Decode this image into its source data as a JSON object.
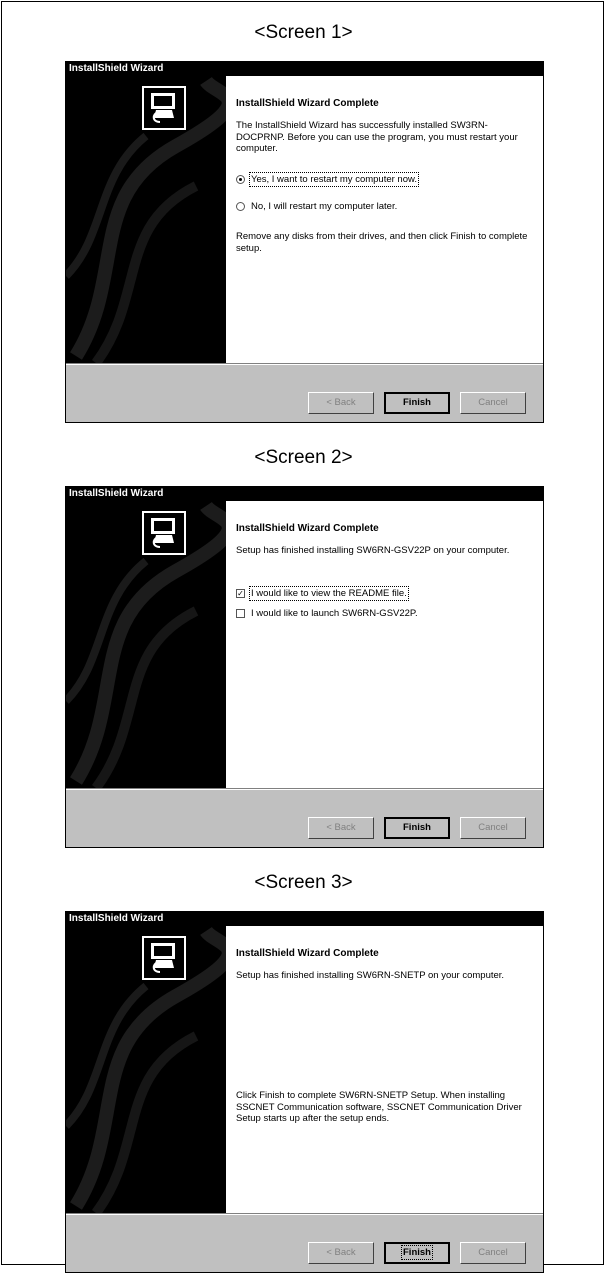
{
  "screens": [
    {
      "caption": "<Screen 1>",
      "title_bar": "InstallShield Wizard",
      "heading": "InstallShield Wizard Complete",
      "body_text": "The InstallShield Wizard has successfully installed SW3RN-DOCPRNP.  Before you can use the program, you must restart your computer.",
      "radio_yes": "Yes, I want to restart my computer now.",
      "radio_no": "No, I will restart my computer later.",
      "footer_text": "Remove any disks from their drives, and then click Finish to complete setup.",
      "back_label": "< Back",
      "finish_label": "Finish",
      "cancel_label": "Cancel"
    },
    {
      "caption": "<Screen 2>",
      "title_bar": "InstallShield Wizard",
      "heading": "InstallShield Wizard Complete",
      "body_text": "Setup has finished installing SW6RN-GSV22P on your computer.",
      "check_readme": "I would like to view the README file.",
      "check_readme_checked": true,
      "check_launch": "I would like to launch SW6RN-GSV22P.",
      "check_launch_checked": false,
      "back_label": "< Back",
      "finish_label": "Finish",
      "cancel_label": "Cancel"
    },
    {
      "caption": "<Screen 3>",
      "title_bar": "InstallShield Wizard",
      "heading": "InstallShield Wizard Complete",
      "body_text": "Setup has finished installing SW6RN-SNETP on your computer.",
      "footer_text": "Click Finish to complete SW6RN-SNETP Setup. When installing SSCNET Communication software, SSCNET Communication Driver Setup starts up after the setup ends.",
      "back_label": "< Back",
      "finish_label": "Finish",
      "cancel_label": "Cancel"
    }
  ],
  "check_mark": "✓"
}
